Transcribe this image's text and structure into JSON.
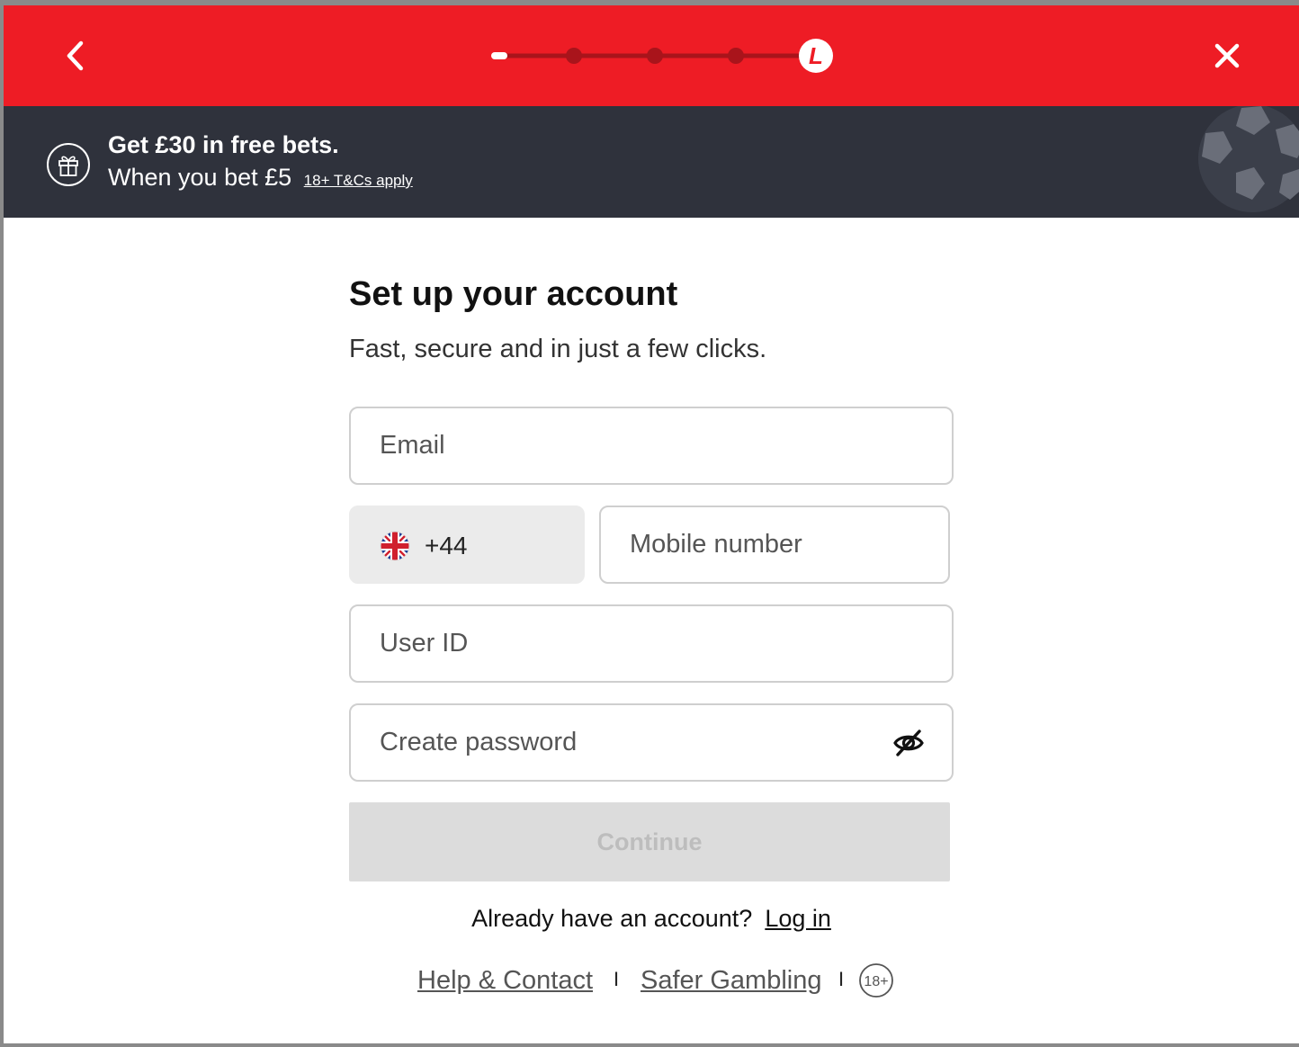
{
  "header": {
    "back_icon": "chevron-left-icon",
    "close_icon": "close-icon",
    "progress": {
      "total_steps": 5,
      "current_step": 5,
      "current_step_glyph": "L"
    },
    "colors": {
      "brand_red": "#ee1c25",
      "promo_bg": "#2f323c"
    }
  },
  "promo": {
    "icon": "gift-icon",
    "title": "Get £30 in free bets.",
    "subtitle": "When you bet £5",
    "terms_link": "18+ T&Cs apply",
    "decoration": "football-icon"
  },
  "form": {
    "title": "Set up your account",
    "subtitle": "Fast, secure and in just a few clicks.",
    "email_placeholder": "Email",
    "country_code": "+44",
    "country_flag": "uk-flag-icon",
    "mobile_placeholder": "Mobile number",
    "userid_placeholder": "User ID",
    "password_placeholder": "Create password",
    "password_toggle_icon": "eye-off-icon",
    "continue_label": "Continue",
    "already_text": "Already have an account?",
    "login_link": "Log in"
  },
  "footer": {
    "help_link": "Help & Contact",
    "separator": "I",
    "safer_link": "Safer Gambling",
    "age_badge": "18+"
  }
}
